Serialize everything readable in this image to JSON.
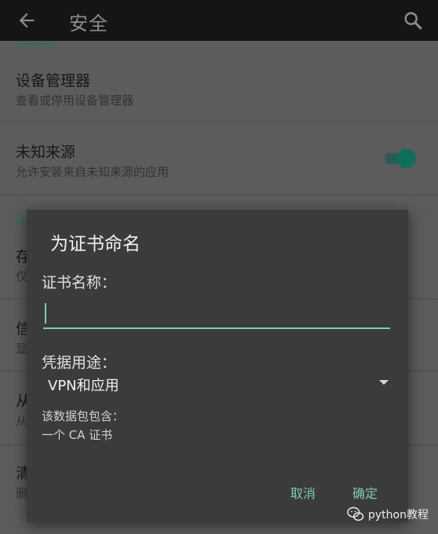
{
  "appbar": {
    "title": "安全",
    "back_icon": "arrow-left-icon",
    "search_icon": "search-icon"
  },
  "settings": {
    "device_admin_title": "设备管理器",
    "device_admin_subtitle": "查看或停用设备管理器",
    "unknown_sources_title": "未知来源",
    "unknown_sources_subtitle": "允许安装来自未知来源的应用",
    "unknown_sources_enabled": true,
    "partial_items": [
      "存",
      "仅",
      "信",
      "显",
      "从",
      "从",
      "清",
      "删"
    ]
  },
  "dialog": {
    "title": "为证书命名",
    "name_label": "证书名称：",
    "name_value": "",
    "usage_label": "凭据用途：",
    "usage_value": "VPN和应用",
    "contains_label": "该数据包包含：",
    "contains_value": "一个 CA 证书",
    "cancel_label": "取消",
    "ok_label": "确定"
  },
  "watermark": {
    "text": "python教程"
  },
  "colors": {
    "accent": "#7fc9b8",
    "dialog_bg": "#3b3b3b",
    "appbar_bg": "#151515"
  }
}
